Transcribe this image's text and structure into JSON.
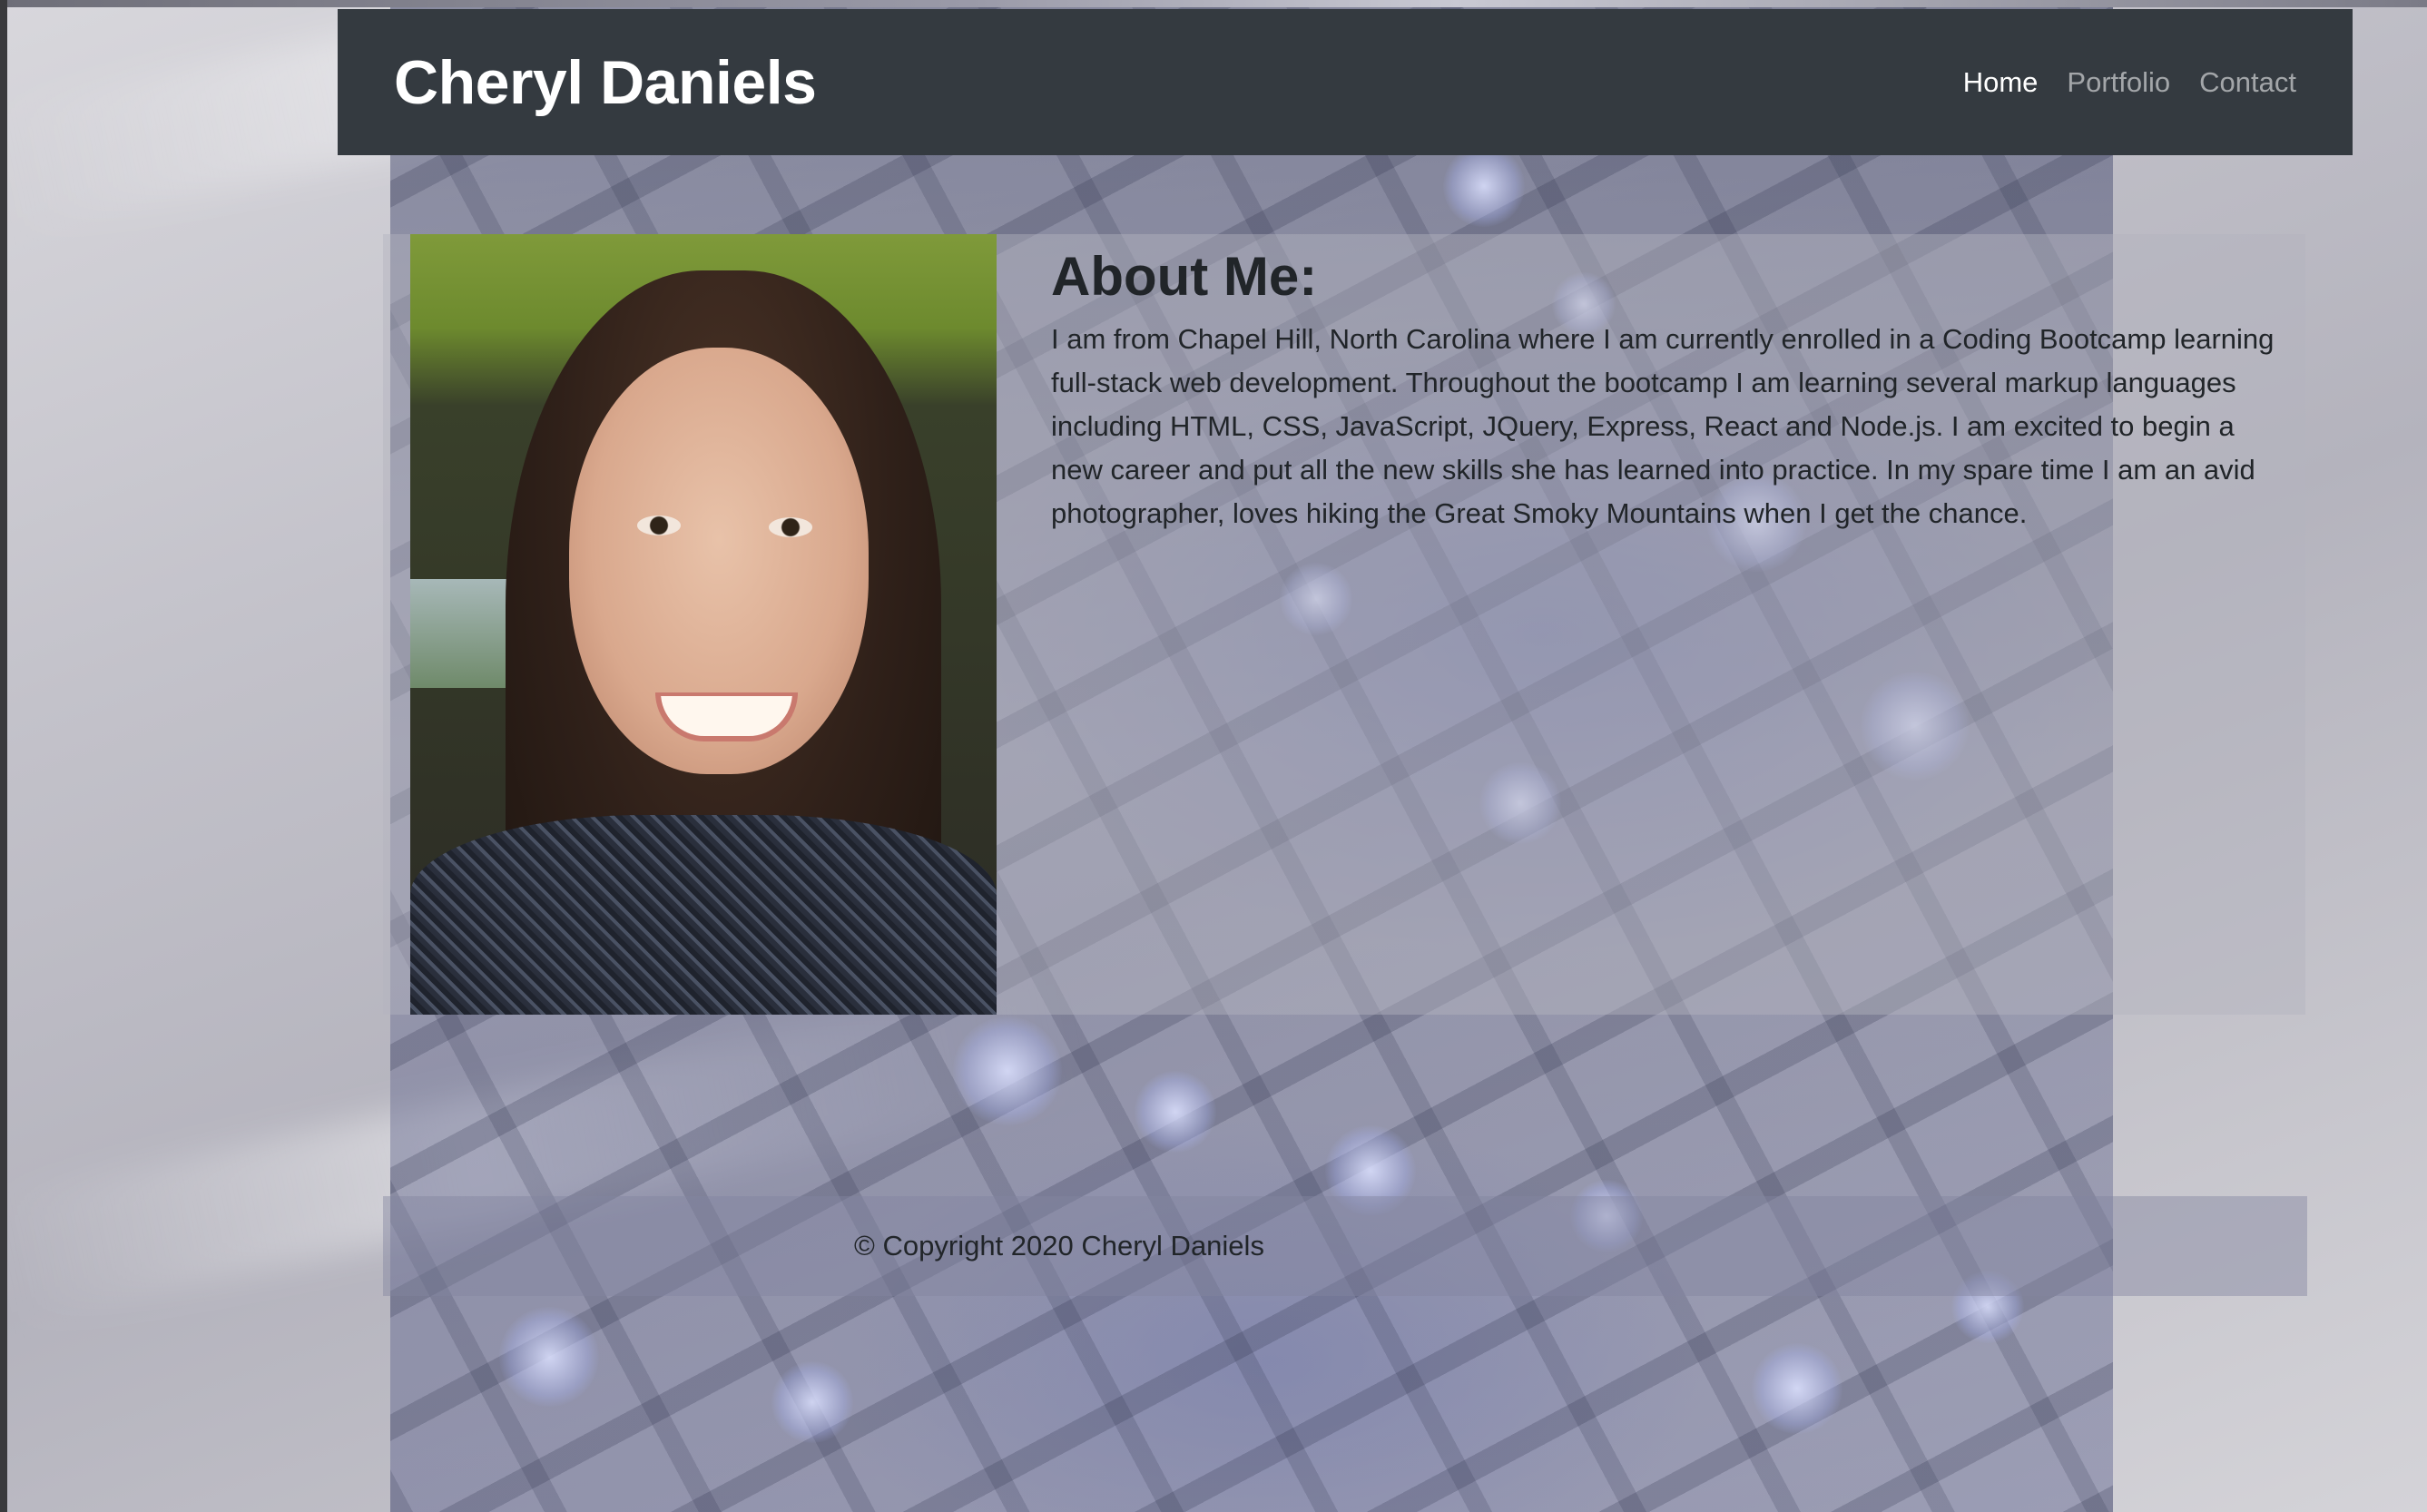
{
  "navbar": {
    "brand": "Cheryl Daniels",
    "links": [
      {
        "label": "Home",
        "active": true
      },
      {
        "label": "Portfolio",
        "active": false
      },
      {
        "label": "Contact",
        "active": false
      }
    ],
    "background_color": "#343a40"
  },
  "about": {
    "title": "About Me:",
    "body": "I am from Chapel Hill, North Carolina where I am currently enrolled in a Coding Bootcamp learning full-stack web development. Throughout the bootcamp I am learning several markup languages including HTML, CSS, JavaScript, JQuery, Express, React and Node.js. I am excited to begin a new career and put all the new skills she has learned into practice. In my spare time I am an avid photographer, loves hiking the Great Smoky Mountains when I get the chance.",
    "photo_alt": "Portrait photo"
  },
  "footer": {
    "text": "© Copyright 2020 Cheryl Daniels"
  },
  "icons": {
    "background": "keyboard-photo-background"
  }
}
